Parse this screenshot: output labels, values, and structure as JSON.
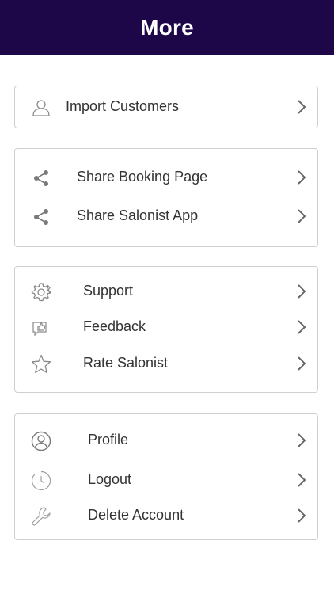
{
  "header": {
    "title": "More"
  },
  "colors": {
    "header_bg": "#1d0749",
    "border": "#cfcfcf",
    "icon": "#8a8a8a",
    "chevron": "#666666"
  },
  "groups": [
    {
      "items": [
        {
          "label": "Import Customers",
          "icon": "person-outline-icon"
        }
      ]
    },
    {
      "items": [
        {
          "label": "Share Booking Page",
          "icon": "share-icon"
        },
        {
          "label": "Share Salonist App",
          "icon": "share-icon"
        }
      ]
    },
    {
      "items": [
        {
          "label": "Support",
          "icon": "gear-icon"
        },
        {
          "label": "Feedback",
          "icon": "feedback-thumbs-up-icon"
        },
        {
          "label": "Rate Salonist",
          "icon": "star-icon"
        }
      ]
    },
    {
      "items": [
        {
          "label": "Profile",
          "icon": "profile-circle-icon"
        },
        {
          "label": "Logout",
          "icon": "logout-clock-icon"
        },
        {
          "label": "Delete Account",
          "icon": "wrench-icon"
        }
      ]
    }
  ]
}
